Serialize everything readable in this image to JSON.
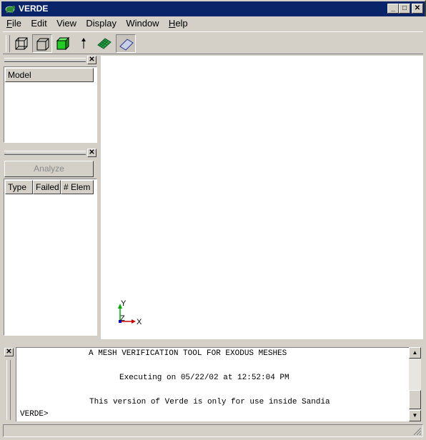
{
  "window": {
    "title": "VERDE"
  },
  "menu": [
    {
      "label": "File",
      "mnemonic": "F",
      "rest": "ile"
    },
    {
      "label": "Edit",
      "mnemonic": "",
      "rest": "Edit"
    },
    {
      "label": "View",
      "mnemonic": "",
      "rest": "View"
    },
    {
      "label": "Display",
      "mnemonic": "",
      "rest": "Display"
    },
    {
      "label": "Window",
      "mnemonic": "",
      "rest": "Window"
    },
    {
      "label": "Help",
      "mnemonic": "H",
      "rest": "elp"
    }
  ],
  "toolbar": {
    "icons": [
      "wireframe-cube-icon",
      "hidden-line-cube-icon",
      "shaded-cube-icon",
      "normal-arrow-icon",
      "mesh-surface-icon",
      "plane-icon"
    ]
  },
  "model_panel": {
    "header": "Model"
  },
  "analysis_panel": {
    "analyze_label": "Analyze",
    "columns": [
      "Type",
      "Failed",
      "# Elem"
    ]
  },
  "axes": {
    "y": "Y",
    "z": "Z",
    "x": "X"
  },
  "console": {
    "lines": [
      "A MESH VERIFICATION TOOL FOR EXODUS MESHES",
      "Executing on 05/22/02 at 12:52:04 PM",
      "This version of Verde is only for use inside Sandia",
      "VERDE>"
    ]
  },
  "colors": {
    "titlebar": "#0a246a",
    "shaded": "#22cc22",
    "mesh": "#2aa84a",
    "axis_y": "#00aa00",
    "axis_x": "#cc0000",
    "axis_z": "#0000cc"
  }
}
